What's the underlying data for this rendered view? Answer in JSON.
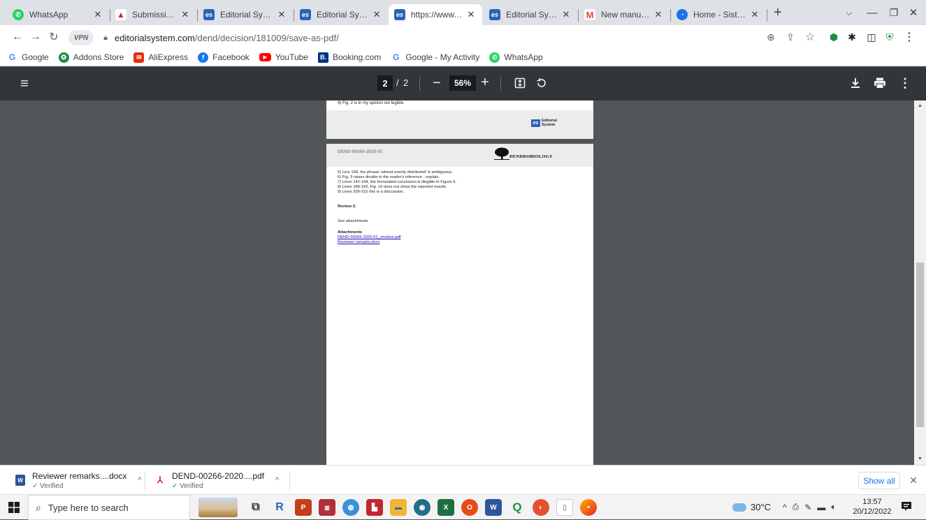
{
  "browser": {
    "tabs": [
      {
        "title": "WhatsApp",
        "favicon": "whatsapp-icon",
        "color": "#25d366",
        "glyph": "✆"
      },
      {
        "title": "Submissions",
        "favicon": "submissions-icon",
        "color": "#c7263b",
        "glyph": "▲"
      },
      {
        "title": "Editorial System",
        "favicon": "editorial-system-icon",
        "color": "#2a64b5",
        "glyph": "es"
      },
      {
        "title": "Editorial System",
        "favicon": "editorial-system-icon",
        "color": "#2a64b5",
        "glyph": "es"
      },
      {
        "title": "https://www.editc",
        "favicon": "editorial-system-icon",
        "color": "#2a64b5",
        "glyph": "es",
        "active": true
      },
      {
        "title": "Editorial System",
        "favicon": "editorial-system-icon",
        "color": "#2a64b5",
        "glyph": "es"
      },
      {
        "title": "New manuscript",
        "favicon": "gmail-icon",
        "color": "#ea4335",
        "glyph": "M"
      },
      {
        "title": "Home - Sistem Pe",
        "favicon": "site-icon",
        "color": "#1a73e8",
        "glyph": "◔"
      }
    ],
    "url_host": "editorialsystem.com",
    "url_path": "/dend/decision/181009/save-as-pdf/",
    "vpn_label": "VPN",
    "bookmarks": [
      {
        "label": "Google",
        "color": "#4285f4",
        "glyph": "G"
      },
      {
        "label": "Addons Store",
        "color": "#1e8e3e",
        "glyph": "✪"
      },
      {
        "label": "AliExpress",
        "color": "#e62e04",
        "glyph": "✉"
      },
      {
        "label": "Facebook",
        "color": "#1877f2",
        "glyph": "f"
      },
      {
        "label": "YouTube",
        "color": "#ff0000",
        "glyph": "▶"
      },
      {
        "label": "Booking.com",
        "color": "#003580",
        "glyph": "B."
      },
      {
        "label": "Google - My Activity",
        "color": "#4285f4",
        "glyph": "G"
      },
      {
        "label": "WhatsApp",
        "color": "#25d366",
        "glyph": "✆"
      }
    ]
  },
  "pdf_viewer": {
    "current_page": "2",
    "page_separator": "/",
    "total_pages": "2",
    "zoom": "56%"
  },
  "document": {
    "page1": {
      "visible_line": "4) Fig. 2 is in my opinion not legible.",
      "footer_logo_text_1": "Editorial",
      "footer_logo_text_2": "System",
      "footer_logo_mark": "es"
    },
    "page2": {
      "manuscript_id": "DEND-00266-2020-01",
      "journal_logo": "DENDROBIOLOGY",
      "lines": [
        "5) Line 138, the phrase 'almost evenly distributed' is ambiguous.",
        "6) Fig. 3 raises doubts in the reader's inference - explain.",
        "7) Lines 142-144, the formulated conclusion is illegible in Figure 5.",
        "8) Lines 189-192, Fig. 10 does not show the reported results.",
        "9) Lines 209-215 this is a discussion."
      ],
      "review2_heading": "Review 2:",
      "review2_text": "See attachments",
      "attachments_heading": "Attachments",
      "attachments": [
        "DEND-00266-2020-01_revision.pdf",
        "Reviewer remarks.docx"
      ]
    }
  },
  "downloads": [
    {
      "name": "Reviewer remarks....docx",
      "status": "Verified",
      "icon": "word-file-icon",
      "color": "#2b579a",
      "glyph": "W"
    },
    {
      "name": "DEND-00266-2020....pdf",
      "status": "Verified",
      "icon": "pdf-file-icon",
      "color": "#d93025",
      "glyph": "⅄"
    }
  ],
  "shelf": {
    "show_all": "Show all"
  },
  "taskbar": {
    "search_placeholder": "Type here to search",
    "weather": "30°C",
    "time": "13:57",
    "date": "20/12/2022"
  }
}
